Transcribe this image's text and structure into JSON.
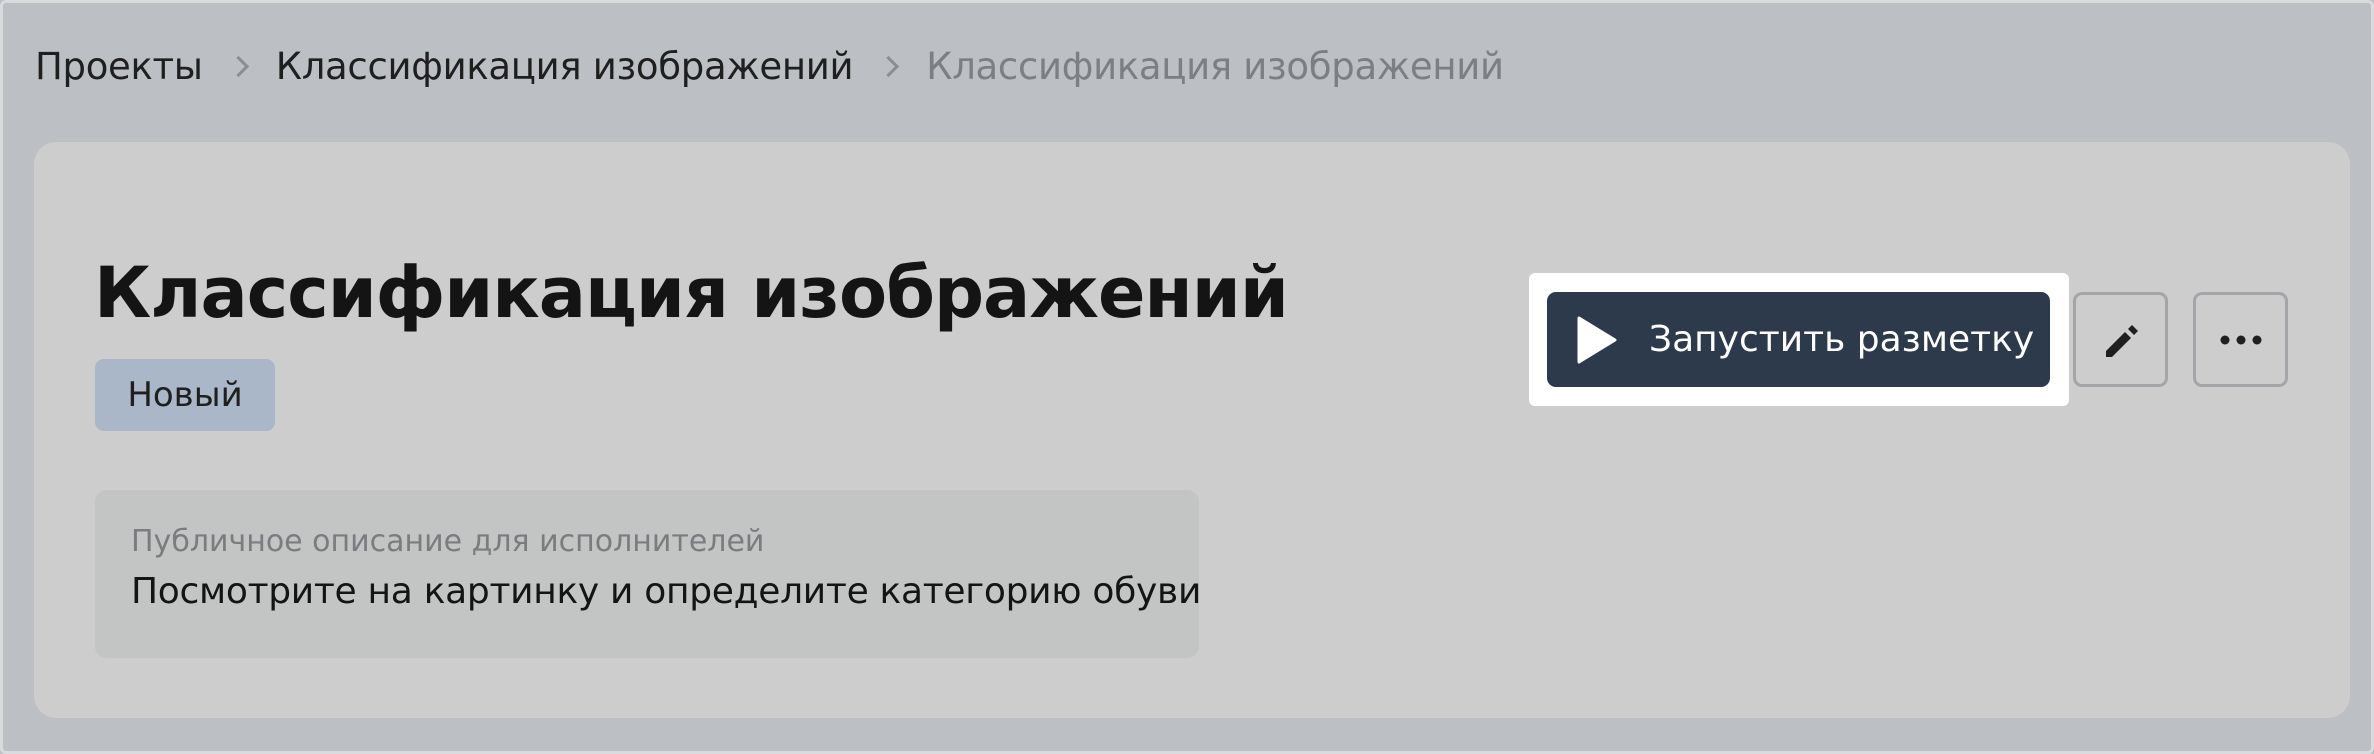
{
  "breadcrumb": {
    "items": [
      "Проекты",
      "Классификация изображений",
      "Классификация изображений"
    ]
  },
  "project": {
    "title": "Классификация изображений",
    "status": "Новый"
  },
  "description": {
    "label": "Публичное описание для исполнителей",
    "text": "Посмотрите на картинку и определите категорию обуви"
  },
  "actions": {
    "run_label": "Запустить разметку",
    "run_icon": "play-icon",
    "edit_icon": "pencil-icon",
    "more_icon": "more-horizontal-icon"
  },
  "colors": {
    "primary_button": "#2c3a4b",
    "status_badge": "#a9b7c9",
    "highlight": "#ffffff"
  }
}
